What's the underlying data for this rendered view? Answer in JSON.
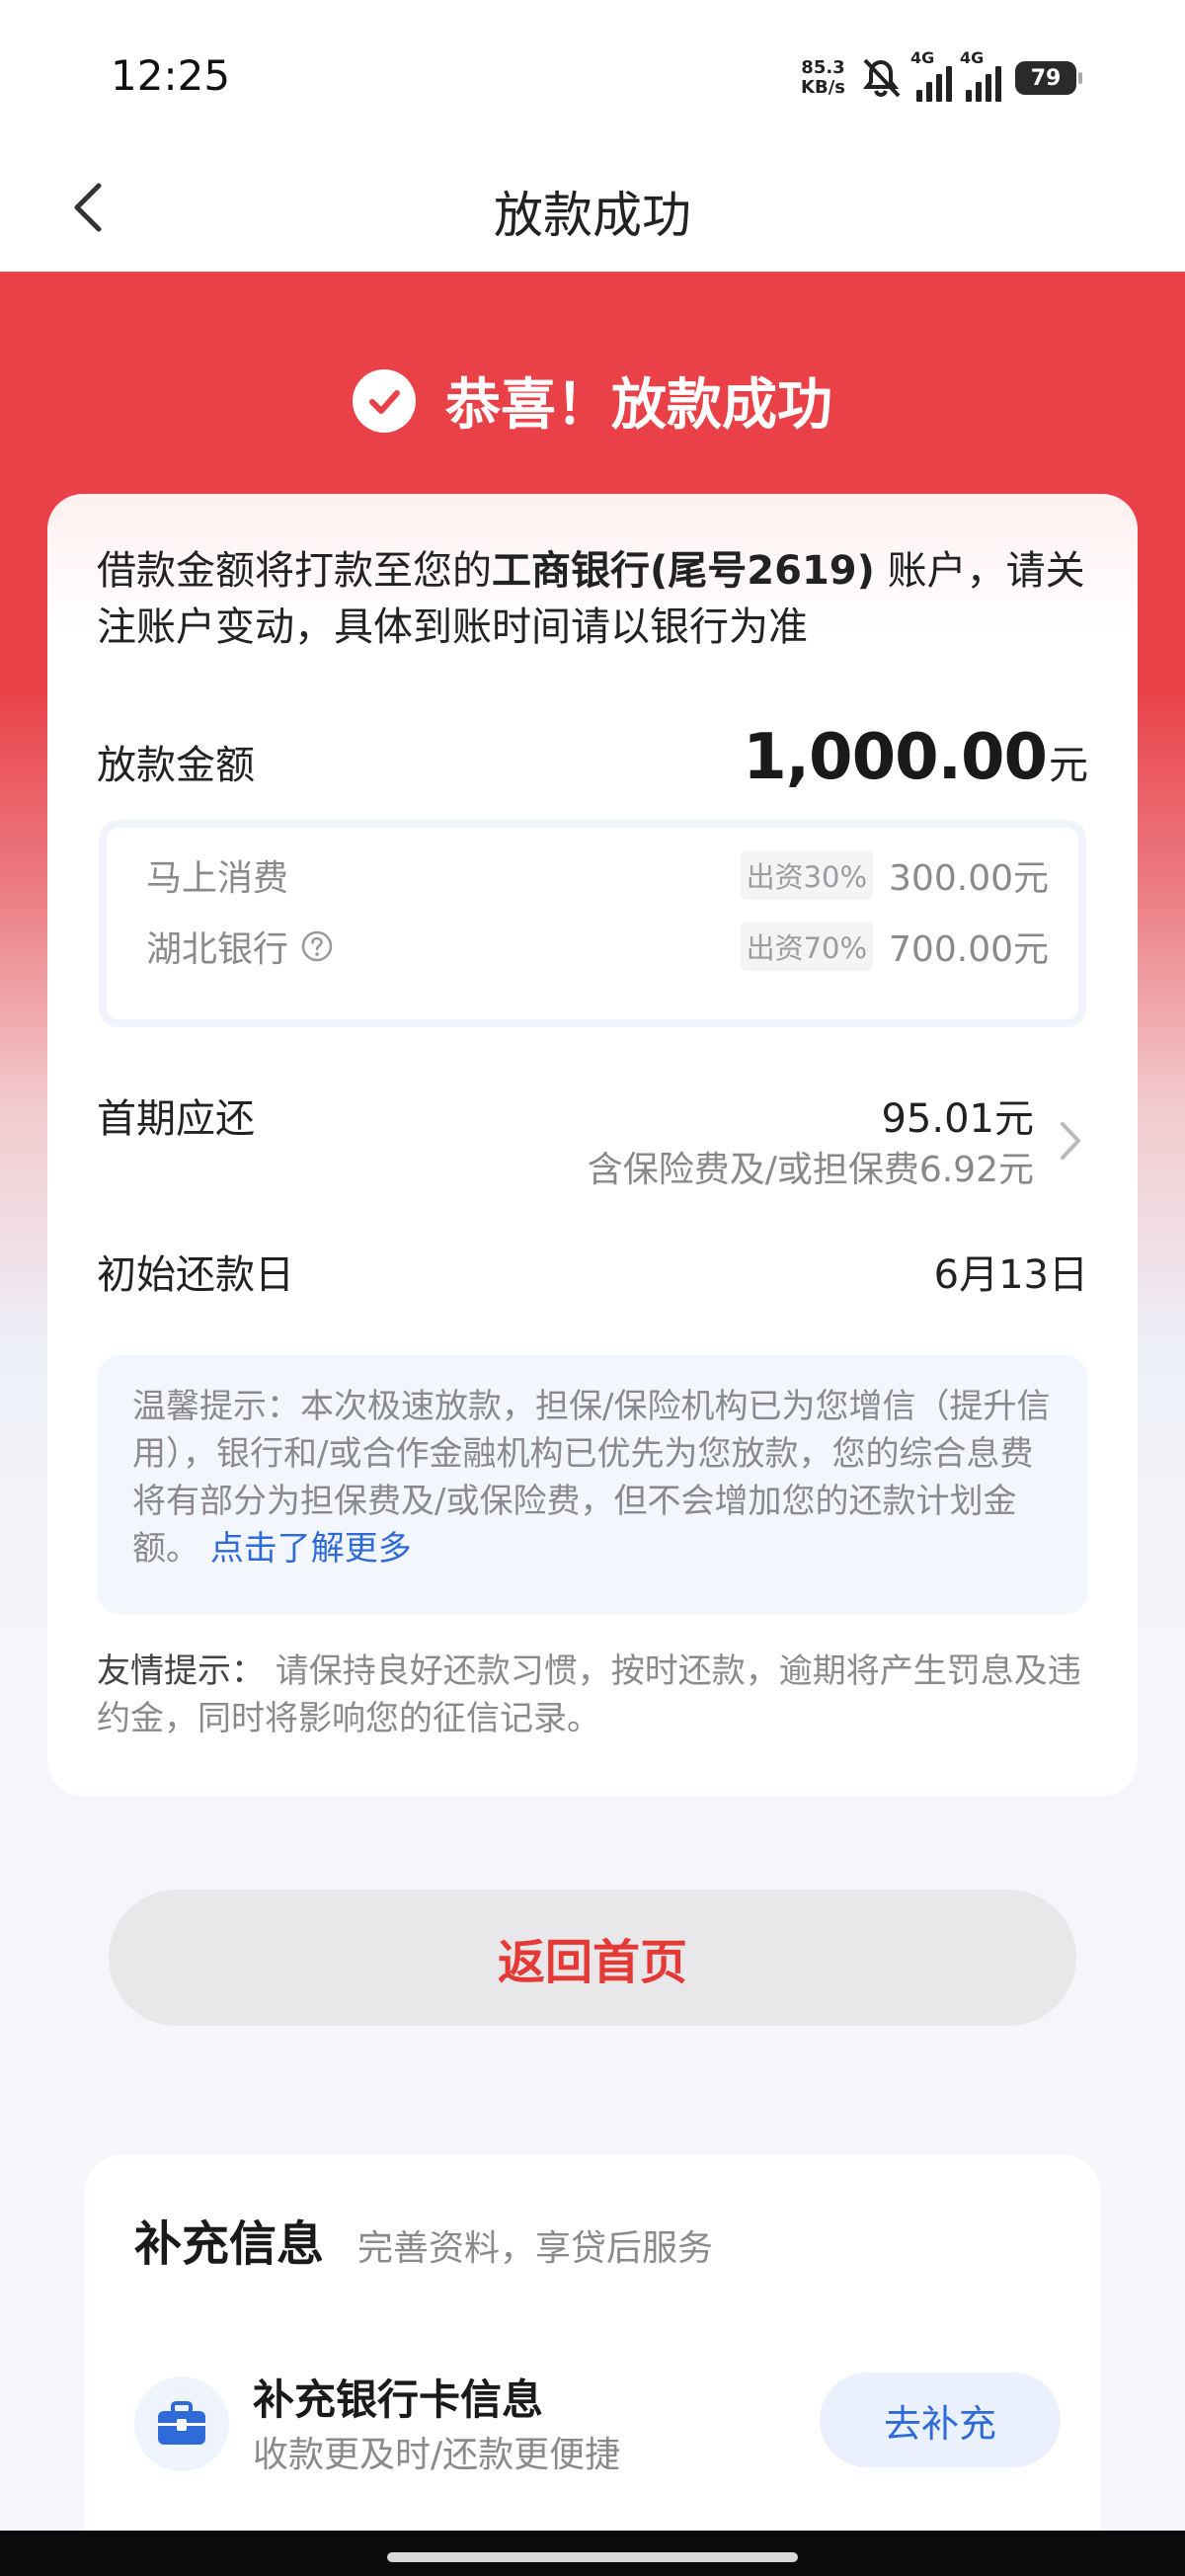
{
  "status_bar": {
    "time": "12:25",
    "net_speed_value": "85.3",
    "net_speed_unit": "KB/s",
    "signal_1_label": "4G",
    "signal_2_label": "4G",
    "battery": "79"
  },
  "nav": {
    "title": "放款成功"
  },
  "hero": {
    "title": "恭喜！放款成功"
  },
  "notice": {
    "prefix": "借款金额将打款至您的",
    "bank": "工商银行(尾号2619)",
    "suffix": " 账户，请关注账户变动，具体到账时间请以银行为准"
  },
  "loan": {
    "label": "放款金额",
    "amount": "1,000.00",
    "unit": "元",
    "funders": [
      {
        "name": "马上消费",
        "share": "出资30%",
        "amount": "300.00元"
      },
      {
        "name": "湖北银行",
        "share": "出资70%",
        "amount": "700.00元"
      }
    ]
  },
  "first_repay": {
    "label": "首期应还",
    "amount": "95.01元",
    "note": "含保险费及/或担保费6.92元"
  },
  "repay_date": {
    "label": "初始还款日",
    "value": "6月13日"
  },
  "tips": {
    "text": "温馨提示：本次极速放款，担保/保险机构已为您增信（提升信用），银行和/或合作金融机构已优先为您放款，您的综合息费将有部分为担保费及/或保险费，但不会增加您的还款计划金额。",
    "link": "点击了解更多"
  },
  "friendly": {
    "label": "友情提示：",
    "text": " 请保持良好还款习惯，按时还款，逾期将产生罚息及违约金，同时将影响您的征信记录。"
  },
  "actions": {
    "home_button": "返回首页"
  },
  "supplement": {
    "title": "补充信息",
    "subtitle": "完善资料，享贷后服务",
    "item_title": "补充银行卡信息",
    "item_subtitle": "收款更及时/还款更便捷",
    "item_button": "去补充"
  },
  "colors": {
    "brand_red": "#ea4149",
    "link_blue": "#2e6bd8"
  }
}
